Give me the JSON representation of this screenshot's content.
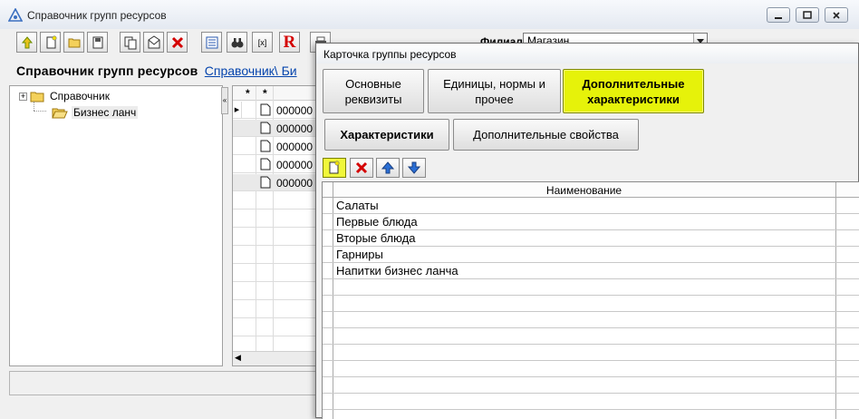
{
  "main_window": {
    "title": "Справочник групп ресурсов",
    "filial_label": "Филиал",
    "filial_value": "Магазин",
    "page_title": "Справочник групп ресурсов",
    "breadcrumb": "Справочник\\ Би",
    "tree": [
      {
        "label": "Справочник",
        "expander": "+"
      },
      {
        "label": "Бизнес ланч"
      }
    ],
    "grid": {
      "header": [
        "*",
        "*"
      ],
      "codes": [
        "000000",
        "000000",
        "000000",
        "000000",
        "000000"
      ]
    },
    "toolbar_letter_r": "R",
    "toolbar_bracket": "[x]"
  },
  "dialog": {
    "title": "Карточка группы ресурсов",
    "tabs": [
      {
        "label": "Основные\nреквизиты",
        "active": false
      },
      {
        "label": "Единицы, нормы и\nпрочее",
        "active": false
      },
      {
        "label": "Дополнительные\nхарактеристики",
        "active": true
      }
    ],
    "subtabs": [
      {
        "label": "Характеристики",
        "active": true
      },
      {
        "label": "Дополнительные свойства",
        "active": false
      }
    ],
    "table": {
      "column": "Наименование",
      "rows": [
        "Салаты",
        "Первые блюда",
        "Вторые блюда",
        "Гарниры",
        "Напитки бизнес ланча"
      ]
    }
  },
  "colors": {
    "active_tab": "#e6f20a",
    "link": "#0645ad",
    "delete_red": "#d40000",
    "arrow_blue": "#2a6fd6"
  }
}
